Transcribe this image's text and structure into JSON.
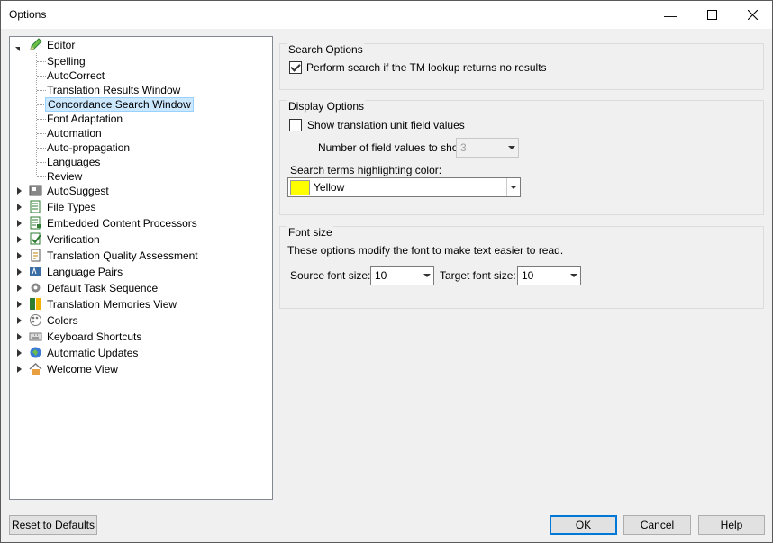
{
  "window": {
    "title": "Options"
  },
  "titlebar": {
    "min": "—",
    "max": "☐",
    "close": "✕"
  },
  "tree": {
    "editor": {
      "label": "Editor",
      "children": [
        "Spelling",
        "AutoCorrect",
        "Translation Results Window",
        "Concordance Search Window",
        "Font Adaptation",
        "Automation",
        "Auto-propagation",
        "Languages",
        "Review"
      ]
    },
    "items": [
      {
        "label": "AutoSuggest",
        "icon": "autosuggest-icon"
      },
      {
        "label": "File Types",
        "icon": "file-types-icon"
      },
      {
        "label": "Embedded Content Processors",
        "icon": "embedded-content-icon"
      },
      {
        "label": "Verification",
        "icon": "verification-icon"
      },
      {
        "label": "Translation Quality Assessment",
        "icon": "tqa-icon"
      },
      {
        "label": "Language Pairs",
        "icon": "language-pairs-icon"
      },
      {
        "label": "Default Task Sequence",
        "icon": "gear-icon"
      },
      {
        "label": "Translation Memories View",
        "icon": "tm-view-icon"
      },
      {
        "label": "Colors",
        "icon": "palette-icon"
      },
      {
        "label": "Keyboard Shortcuts",
        "icon": "keyboard-icon"
      },
      {
        "label": "Automatic Updates",
        "icon": "globe-update-icon"
      },
      {
        "label": "Welcome View",
        "icon": "home-icon"
      }
    ]
  },
  "search_options": {
    "title": "Search Options",
    "perform_search_label": "Perform search if the TM lookup returns no results",
    "perform_search_checked": true
  },
  "display_options": {
    "title": "Display Options",
    "show_field_values_label": "Show translation unit field values",
    "show_field_values_checked": false,
    "num_field_values_label": "Number of field values to show:",
    "num_field_values_value": "3",
    "highlight_color_label": "Search terms highlighting color:",
    "highlight_color_value": "Yellow",
    "highlight_color_swatch": "#ffff00"
  },
  "font_size": {
    "title": "Font size",
    "description": "These options modify the font to make text easier to read.",
    "source_label": "Source font size:",
    "source_value": "10",
    "target_label": "Target font size:",
    "target_value": "10"
  },
  "buttons": {
    "reset": "Reset to Defaults",
    "ok": "OK",
    "cancel": "Cancel",
    "help": "Help"
  },
  "colors": {
    "selection_bg": "#cce8ff",
    "default_button_border": "#0078d7"
  }
}
